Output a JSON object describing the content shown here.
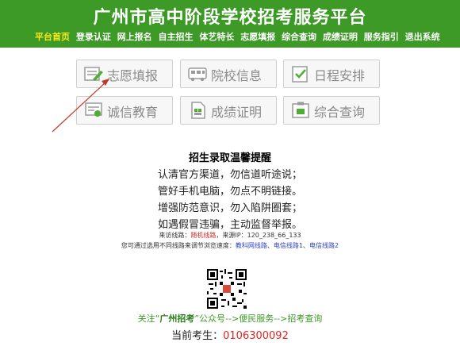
{
  "header": {
    "title": "广州市高中阶段学校招考服务平台",
    "nav": [
      "平台首页",
      "登录认证",
      "网上报名",
      "自主招生",
      "体艺特长",
      "志愿填报",
      "综合查询",
      "成绩证明",
      "服务指引",
      "退出系统"
    ]
  },
  "tiles": [
    {
      "label": "志愿填报",
      "icon": "form-icon"
    },
    {
      "label": "院校信息",
      "icon": "school-bus-icon"
    },
    {
      "label": "日程安排",
      "icon": "calendar-check-icon"
    },
    {
      "label": "诚信教育",
      "icon": "certificate-icon"
    },
    {
      "label": "成绩证明",
      "icon": "document-icon"
    },
    {
      "label": "综合查询",
      "icon": "search-folder-icon"
    }
  ],
  "reminder": {
    "title": "招生录取温馨提醒",
    "lines": [
      "认清官方渠道，勿信道听途说；",
      "管好手机电脑，勿点不明链接。",
      "增强防范意识，勿入陷阱圈套；",
      "如遇假冒违骗，主动监督举报。"
    ]
  },
  "access": {
    "prefix": "来访线路：",
    "route": "随机线路",
    "source_prefix": "，来源IP：",
    "ip": "120_238_66_133"
  },
  "routes": {
    "prefix": "您可通过选用不同线路来调节浏览速度：",
    "links": [
      "教科网线路",
      "电信线路1",
      "电信线路2"
    ],
    "sep1": "、",
    "sep2": "、"
  },
  "follow": {
    "pre": "关注“",
    "account": "广州招考",
    "post": "”公众号-->便民服务-->招考查询"
  },
  "current": {
    "label": "当前考生：",
    "number": "0106300092"
  },
  "colors": {
    "header": "#3d9a27",
    "nav_active": "#ffe81a"
  }
}
